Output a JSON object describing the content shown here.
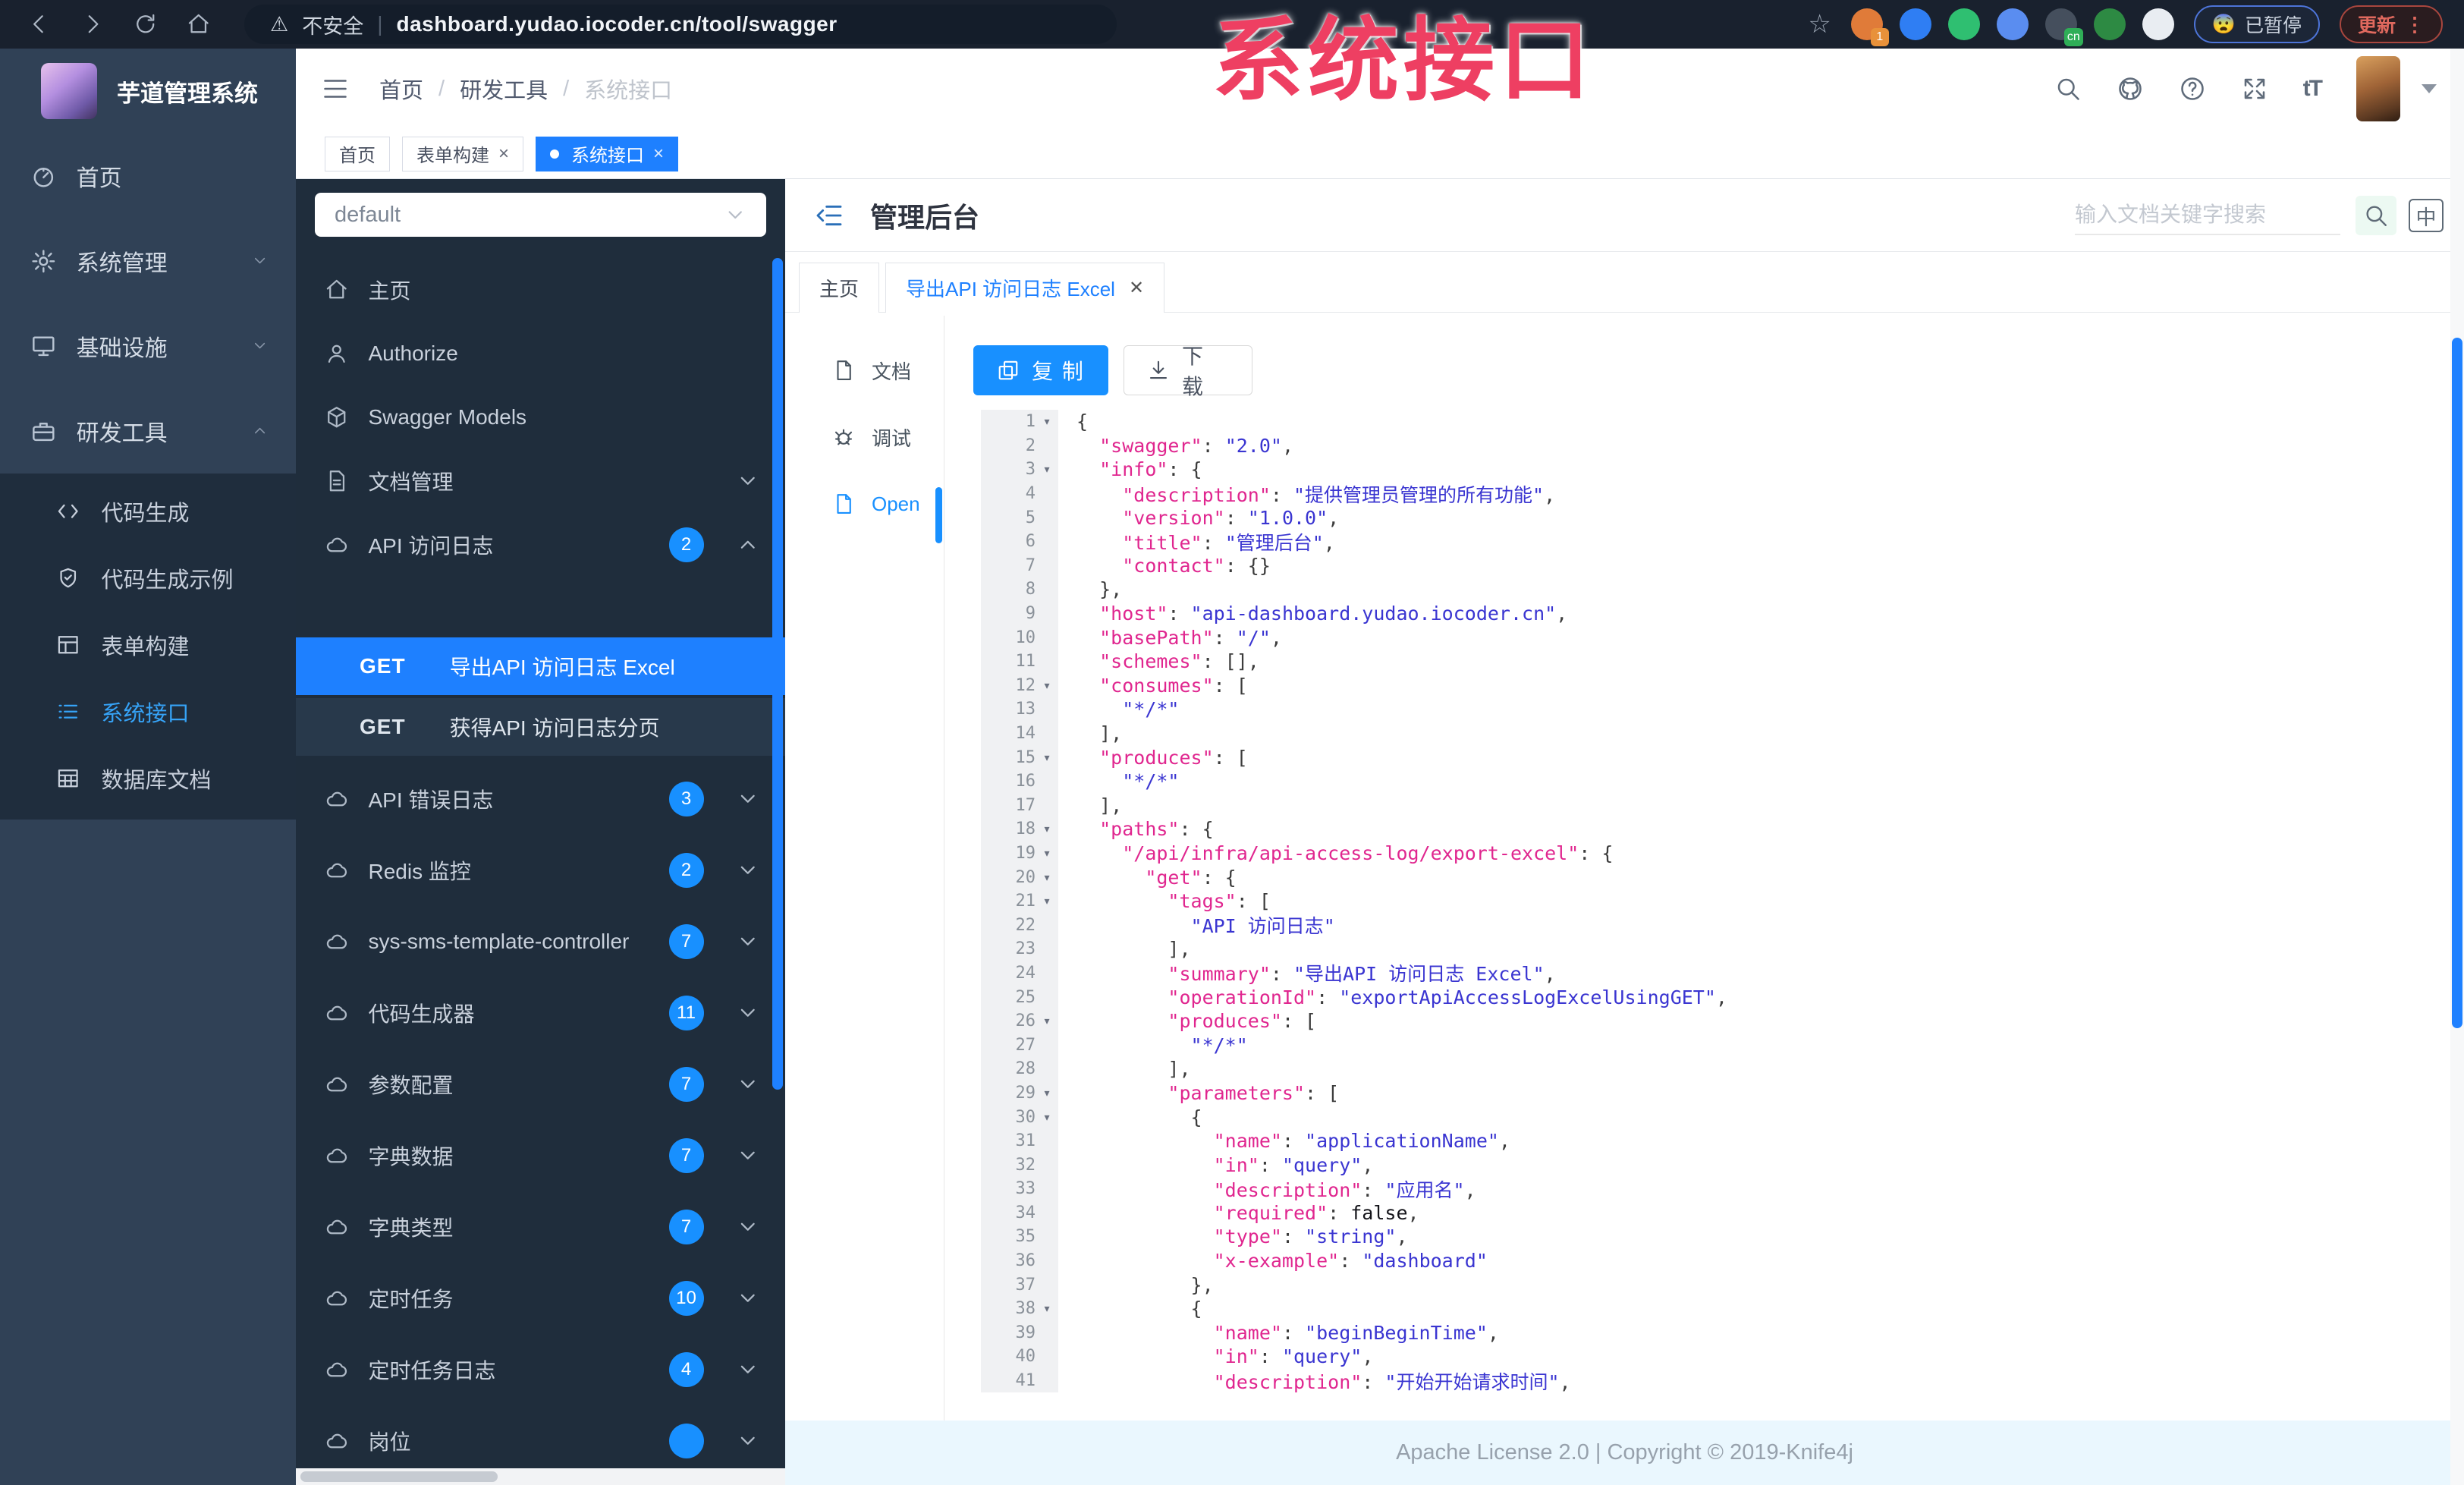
{
  "colors": {
    "accent": "#1890ff",
    "selected_operation_bg": "#1e80ff",
    "sidebar_bg": "#304156",
    "submenu_bg": "#1f2d3d",
    "doc_panel_bg": "#1f2d3c",
    "chrome_bg": "#19212e",
    "watermark_color": "#ee3f62",
    "footer_bg": "#eaf7fe",
    "json_key_color": "#e0268f",
    "json_string_color": "#3a35d1"
  },
  "watermark": {
    "text": "系统接口"
  },
  "browser": {
    "security_label": "不安全",
    "url": "dashboard.yudao.iocoder.cn/tool/swagger",
    "paused_label": "已暂停",
    "paused_emoji": "😨",
    "update_label": "更新",
    "update_dots": "⋮",
    "extensions": [
      {
        "icon": "orange-ring-extension",
        "color": "#e07b39",
        "badge": "1"
      },
      {
        "icon": "blue-drop-extension",
        "color": "#2f7ef3",
        "badge": ""
      },
      {
        "icon": "green-check-extension",
        "color": "#2fbf71",
        "badge": ""
      },
      {
        "icon": "blue-grid-extension",
        "color": "#5a8df0",
        "badge": ""
      },
      {
        "icon": "cn-translate-extension",
        "color": "#454f5d",
        "badge": "cn"
      },
      {
        "icon": "green-leaf-extension",
        "color": "#2d8a43",
        "badge": ""
      },
      {
        "icon": "white-flower-extension",
        "color": "#e9edf2",
        "badge": ""
      }
    ]
  },
  "sidebar": {
    "app_title": "芋道管理系统",
    "items": [
      {
        "label": "首页",
        "icon": "dashboard",
        "chevron": ""
      },
      {
        "label": "系统管理",
        "icon": "gear",
        "chevron": "down"
      },
      {
        "label": "基础设施",
        "icon": "infra",
        "chevron": "down"
      },
      {
        "label": "研发工具",
        "icon": "tools",
        "chevron": "up"
      }
    ],
    "subitems": [
      {
        "label": "代码生成",
        "icon": "code",
        "active": false
      },
      {
        "label": "代码生成示例",
        "icon": "shield",
        "active": false
      },
      {
        "label": "表单构建",
        "icon": "form",
        "active": false
      },
      {
        "label": "系统接口",
        "icon": "list",
        "active": true
      },
      {
        "label": "数据库文档",
        "icon": "db",
        "active": false
      }
    ]
  },
  "header": {
    "breadcrumb": [
      "首页",
      "研发工具",
      "系统接口"
    ],
    "tags": [
      {
        "label": "首页",
        "closable": false,
        "active": false
      },
      {
        "label": "表单构建",
        "closable": true,
        "active": false
      },
      {
        "label": "系统接口",
        "closable": true,
        "active": true
      }
    ]
  },
  "docpanel": {
    "group_value": "default",
    "items": [
      {
        "label": "主页",
        "icon": "home",
        "badge": "",
        "chevron": ""
      },
      {
        "label": "Authorize",
        "icon": "auth",
        "badge": "",
        "chevron": ""
      },
      {
        "label": "Swagger Models",
        "icon": "cube",
        "badge": "",
        "chevron": ""
      },
      {
        "label": "文档管理",
        "icon": "doc",
        "badge": "",
        "chevron": "down"
      },
      {
        "label": "API 访问日志",
        "icon": "cloud",
        "badge": "2",
        "chevron": "up"
      }
    ],
    "operations": [
      {
        "method": "GET",
        "label": "导出API 访问日志 Excel",
        "selected": true
      },
      {
        "method": "GET",
        "label": "获得API 访问日志分页",
        "selected": false
      }
    ],
    "groups": [
      {
        "label": "API 错误日志",
        "icon": "cloud",
        "badge": "3"
      },
      {
        "label": "Redis 监控",
        "icon": "cloud",
        "badge": "2"
      },
      {
        "label": "sys-sms-template-controller",
        "icon": "cloud",
        "badge": "7"
      },
      {
        "label": "代码生成器",
        "icon": "cloud",
        "badge": "11"
      },
      {
        "label": "参数配置",
        "icon": "cloud",
        "badge": "7"
      },
      {
        "label": "字典数据",
        "icon": "cloud",
        "badge": "7"
      },
      {
        "label": "字典类型",
        "icon": "cloud",
        "badge": "7"
      },
      {
        "label": "定时任务",
        "icon": "cloud",
        "badge": "10"
      },
      {
        "label": "定时任务日志",
        "icon": "cloud",
        "badge": "4"
      },
      {
        "label": "岗位",
        "icon": "cloud",
        "badge": ""
      }
    ]
  },
  "main": {
    "title": "管理后台",
    "search_placeholder": "输入文档关键字搜索",
    "lang_toggle": "中",
    "tabs": [
      {
        "label": "主页",
        "closable": false,
        "active": false
      },
      {
        "label": "导出API 访问日志 Excel",
        "closable": true,
        "active": true
      }
    ],
    "side_nav": [
      {
        "label": "文档",
        "icon": "page",
        "active": false
      },
      {
        "label": "调试",
        "icon": "debug",
        "active": false
      },
      {
        "label": "Open",
        "icon": "page",
        "active": true
      }
    ],
    "copy_button": "复 制",
    "download_button": "下 载",
    "footer": "Apache License 2.0 | Copyright © 2019-Knife4j"
  },
  "code": {
    "lines": [
      {
        "n": 1,
        "f": 1,
        "t": [
          [
            "p",
            "{"
          ]
        ]
      },
      {
        "n": 2,
        "t": [
          [
            "p",
            "  "
          ],
          [
            "k",
            "\"swagger\""
          ],
          [
            "p",
            ": "
          ],
          [
            "s",
            "\"2.0\""
          ],
          [
            "p",
            ","
          ]
        ]
      },
      {
        "n": 3,
        "f": 1,
        "t": [
          [
            "p",
            "  "
          ],
          [
            "k",
            "\"info\""
          ],
          [
            "p",
            ": {"
          ]
        ]
      },
      {
        "n": 4,
        "t": [
          [
            "p",
            "    "
          ],
          [
            "k",
            "\"description\""
          ],
          [
            "p",
            ": "
          ],
          [
            "s",
            "\"提供管理员管理的所有功能\""
          ],
          [
            "p",
            ","
          ]
        ]
      },
      {
        "n": 5,
        "t": [
          [
            "p",
            "    "
          ],
          [
            "k",
            "\"version\""
          ],
          [
            "p",
            ": "
          ],
          [
            "s",
            "\"1.0.0\""
          ],
          [
            "p",
            ","
          ]
        ]
      },
      {
        "n": 6,
        "t": [
          [
            "p",
            "    "
          ],
          [
            "k",
            "\"title\""
          ],
          [
            "p",
            ": "
          ],
          [
            "s",
            "\"管理后台\""
          ],
          [
            "p",
            ","
          ]
        ]
      },
      {
        "n": 7,
        "t": [
          [
            "p",
            "    "
          ],
          [
            "k",
            "\"contact\""
          ],
          [
            "p",
            ": {}"
          ]
        ]
      },
      {
        "n": 8,
        "t": [
          [
            "p",
            "  },"
          ]
        ]
      },
      {
        "n": 9,
        "t": [
          [
            "p",
            "  "
          ],
          [
            "k",
            "\"host\""
          ],
          [
            "p",
            ": "
          ],
          [
            "s",
            "\"api-dashboard.yudao.iocoder.cn\""
          ],
          [
            "p",
            ","
          ]
        ]
      },
      {
        "n": 10,
        "t": [
          [
            "p",
            "  "
          ],
          [
            "k",
            "\"basePath\""
          ],
          [
            "p",
            ": "
          ],
          [
            "s",
            "\"/\""
          ],
          [
            "p",
            ","
          ]
        ]
      },
      {
        "n": 11,
        "t": [
          [
            "p",
            "  "
          ],
          [
            "k",
            "\"schemes\""
          ],
          [
            "p",
            ": [],"
          ]
        ]
      },
      {
        "n": 12,
        "f": 1,
        "t": [
          [
            "p",
            "  "
          ],
          [
            "k",
            "\"consumes\""
          ],
          [
            "p",
            ": ["
          ]
        ]
      },
      {
        "n": 13,
        "t": [
          [
            "p",
            "    "
          ],
          [
            "s",
            "\"*/*\""
          ]
        ]
      },
      {
        "n": 14,
        "t": [
          [
            "p",
            "  ],"
          ]
        ]
      },
      {
        "n": 15,
        "f": 1,
        "t": [
          [
            "p",
            "  "
          ],
          [
            "k",
            "\"produces\""
          ],
          [
            "p",
            ": ["
          ]
        ]
      },
      {
        "n": 16,
        "t": [
          [
            "p",
            "    "
          ],
          [
            "s",
            "\"*/*\""
          ]
        ]
      },
      {
        "n": 17,
        "t": [
          [
            "p",
            "  ],"
          ]
        ]
      },
      {
        "n": 18,
        "f": 1,
        "t": [
          [
            "p",
            "  "
          ],
          [
            "k",
            "\"paths\""
          ],
          [
            "p",
            ": {"
          ]
        ]
      },
      {
        "n": 19,
        "f": 1,
        "t": [
          [
            "p",
            "    "
          ],
          [
            "k",
            "\"/api/infra/api-access-log/export-excel\""
          ],
          [
            "p",
            ": {"
          ]
        ]
      },
      {
        "n": 20,
        "f": 1,
        "t": [
          [
            "p",
            "      "
          ],
          [
            "k",
            "\"get\""
          ],
          [
            "p",
            ": {"
          ]
        ]
      },
      {
        "n": 21,
        "f": 1,
        "t": [
          [
            "p",
            "        "
          ],
          [
            "k",
            "\"tags\""
          ],
          [
            "p",
            ": ["
          ]
        ]
      },
      {
        "n": 22,
        "t": [
          [
            "p",
            "          "
          ],
          [
            "s",
            "\"API 访问日志\""
          ]
        ]
      },
      {
        "n": 23,
        "t": [
          [
            "p",
            "        ],"
          ]
        ]
      },
      {
        "n": 24,
        "t": [
          [
            "p",
            "        "
          ],
          [
            "k",
            "\"summary\""
          ],
          [
            "p",
            ": "
          ],
          [
            "s",
            "\"导出API 访问日志 Excel\""
          ],
          [
            "p",
            ","
          ]
        ]
      },
      {
        "n": 25,
        "t": [
          [
            "p",
            "        "
          ],
          [
            "k",
            "\"operationId\""
          ],
          [
            "p",
            ": "
          ],
          [
            "s",
            "\"exportApiAccessLogExcelUsingGET\""
          ],
          [
            "p",
            ","
          ]
        ]
      },
      {
        "n": 26,
        "f": 1,
        "t": [
          [
            "p",
            "        "
          ],
          [
            "k",
            "\"produces\""
          ],
          [
            "p",
            ": ["
          ]
        ]
      },
      {
        "n": 27,
        "t": [
          [
            "p",
            "          "
          ],
          [
            "s",
            "\"*/*\""
          ]
        ]
      },
      {
        "n": 28,
        "t": [
          [
            "p",
            "        ],"
          ]
        ]
      },
      {
        "n": 29,
        "f": 1,
        "t": [
          [
            "p",
            "        "
          ],
          [
            "k",
            "\"parameters\""
          ],
          [
            "p",
            ": ["
          ]
        ]
      },
      {
        "n": 30,
        "f": 1,
        "t": [
          [
            "p",
            "          {"
          ]
        ]
      },
      {
        "n": 31,
        "t": [
          [
            "p",
            "            "
          ],
          [
            "k",
            "\"name\""
          ],
          [
            "p",
            ": "
          ],
          [
            "s",
            "\"applicationName\""
          ],
          [
            "p",
            ","
          ]
        ]
      },
      {
        "n": 32,
        "t": [
          [
            "p",
            "            "
          ],
          [
            "k",
            "\"in\""
          ],
          [
            "p",
            ": "
          ],
          [
            "s",
            "\"query\""
          ],
          [
            "p",
            ","
          ]
        ]
      },
      {
        "n": 33,
        "t": [
          [
            "p",
            "            "
          ],
          [
            "k",
            "\"description\""
          ],
          [
            "p",
            ": "
          ],
          [
            "s",
            "\"应用名\""
          ],
          [
            "p",
            ","
          ]
        ]
      },
      {
        "n": 34,
        "t": [
          [
            "p",
            "            "
          ],
          [
            "k",
            "\"required\""
          ],
          [
            "p",
            ": "
          ],
          [
            "b",
            "false"
          ],
          [
            "p",
            ","
          ]
        ]
      },
      {
        "n": 35,
        "t": [
          [
            "p",
            "            "
          ],
          [
            "k",
            "\"type\""
          ],
          [
            "p",
            ": "
          ],
          [
            "s",
            "\"string\""
          ],
          [
            "p",
            ","
          ]
        ]
      },
      {
        "n": 36,
        "t": [
          [
            "p",
            "            "
          ],
          [
            "k",
            "\"x-example\""
          ],
          [
            "p",
            ": "
          ],
          [
            "s",
            "\"dashboard\""
          ]
        ]
      },
      {
        "n": 37,
        "t": [
          [
            "p",
            "          },"
          ]
        ]
      },
      {
        "n": 38,
        "f": 1,
        "t": [
          [
            "p",
            "          {"
          ]
        ]
      },
      {
        "n": 39,
        "t": [
          [
            "p",
            "            "
          ],
          [
            "k",
            "\"name\""
          ],
          [
            "p",
            ": "
          ],
          [
            "s",
            "\"beginBeginTime\""
          ],
          [
            "p",
            ","
          ]
        ]
      },
      {
        "n": 40,
        "t": [
          [
            "p",
            "            "
          ],
          [
            "k",
            "\"in\""
          ],
          [
            "p",
            ": "
          ],
          [
            "s",
            "\"query\""
          ],
          [
            "p",
            ","
          ]
        ]
      },
      {
        "n": 41,
        "t": [
          [
            "p",
            "            "
          ],
          [
            "k",
            "\"description\""
          ],
          [
            "p",
            ": "
          ],
          [
            "s",
            "\"开始开始请求时间\""
          ],
          [
            "p",
            ","
          ]
        ]
      }
    ]
  }
}
